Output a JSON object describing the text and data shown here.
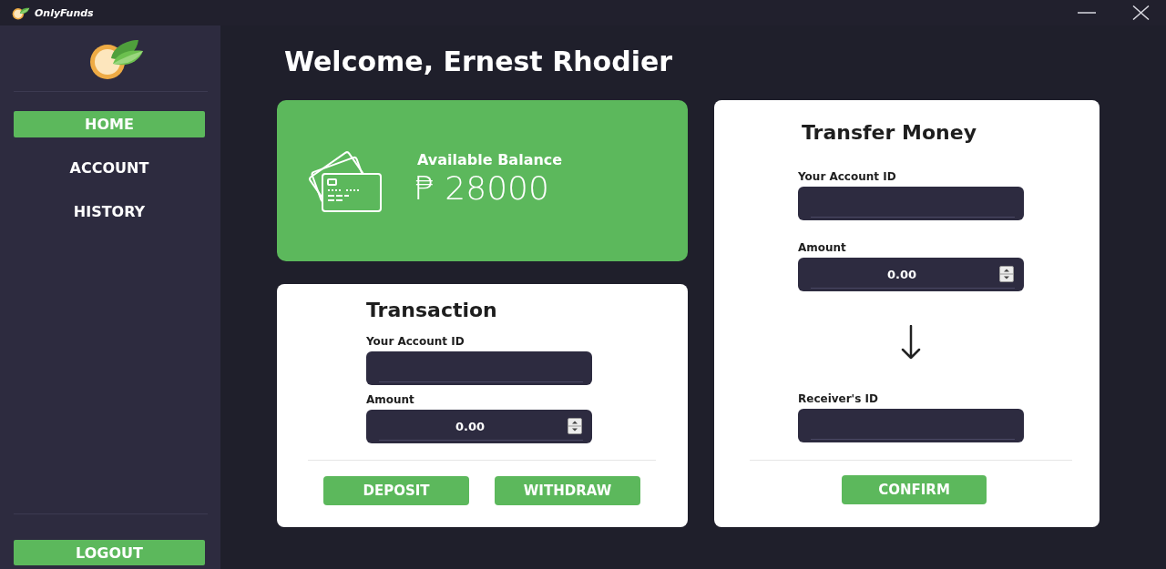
{
  "window": {
    "title": "OnlyFunds"
  },
  "sidebar": {
    "items": [
      {
        "label": "HOME",
        "selected": true
      },
      {
        "label": "ACCOUNT",
        "selected": false
      },
      {
        "label": "HISTORY",
        "selected": false
      }
    ],
    "logout": "LOGOUT"
  },
  "header": {
    "title": "Welcome, Ernest Rhodier"
  },
  "balance_card": {
    "label": "Available Balance",
    "amount": "₱ 28000"
  },
  "transaction": {
    "title": "Transaction",
    "fields": [
      {
        "kind": "text",
        "label": "Your Account ID"
      },
      {
        "kind": "number",
        "label": "Amount",
        "value": "0.00"
      }
    ],
    "buttons": [
      "DEPOSIT",
      "WITHDRAW"
    ]
  },
  "transfer": {
    "title": "Transfer Money",
    "sender_fields": [
      {
        "kind": "text",
        "label": "Your Account ID"
      },
      {
        "kind": "number",
        "label": "Amount",
        "value": "0.00"
      }
    ],
    "receiver_fields": [
      {
        "kind": "text",
        "label": "Receiver's ID"
      }
    ],
    "button": "CONFIRM"
  }
}
